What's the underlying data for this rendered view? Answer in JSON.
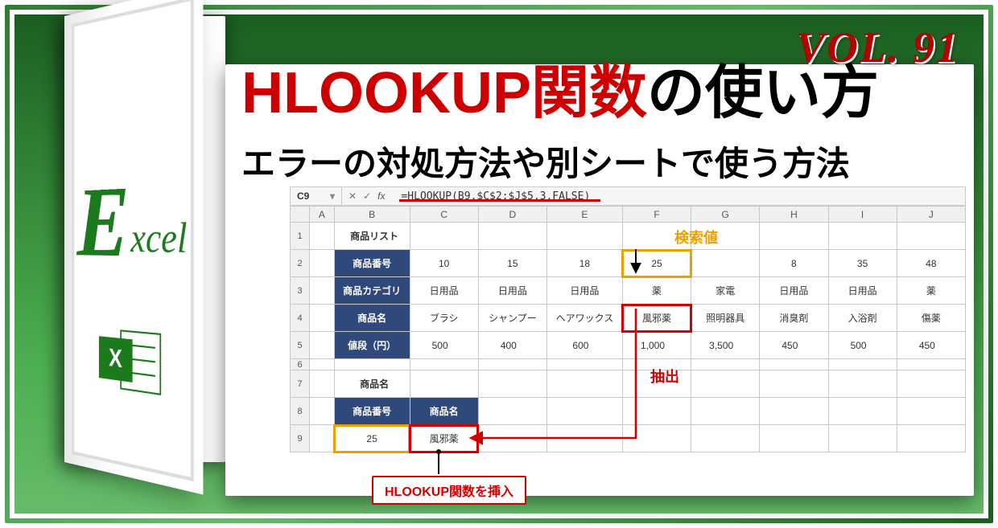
{
  "volume_label": "VOL. 91",
  "title": {
    "red": "HLOOKUP関数",
    "black": "の使い方"
  },
  "subtitle": "エラーの対処方法や別シートで使う方法",
  "door": {
    "letter": "E",
    "rest": "xcel",
    "icon_letter": "X"
  },
  "formula_bar": {
    "cell_ref": "C9",
    "dropdown_glyph": "▾",
    "cancel_glyph": "✕",
    "confirm_glyph": "✓",
    "fx_label": "fx",
    "formula": "=HLOOKUP(B9,$C$2:$J$5,3,FALSE)"
  },
  "columns": [
    "",
    "A",
    "B",
    "C",
    "D",
    "E",
    "F",
    "G",
    "H",
    "I",
    "J"
  ],
  "row_labels": [
    "1",
    "2",
    "3",
    "4",
    "5",
    "6",
    "7",
    "8",
    "9"
  ],
  "sheet": {
    "list_title": "商品リスト",
    "headers": {
      "number": "商品番号",
      "category": "商品カテゴリ",
      "name": "商品名",
      "price": "値段（円）"
    },
    "data": {
      "numbers": [
        "10",
        "15",
        "18",
        "25",
        "",
        "8",
        "35",
        "48"
      ],
      "categories": [
        "日用品",
        "日用品",
        "日用品",
        "薬",
        "家電",
        "日用品",
        "日用品",
        "薬"
      ],
      "names": [
        "ブラシ",
        "シャンプー",
        "ヘアワックス",
        "風邪薬",
        "照明器具",
        "消臭剤",
        "入浴剤",
        "傷薬"
      ],
      "prices": [
        "500",
        "400",
        "600",
        "1,000",
        "3,500",
        "450",
        "500",
        "450"
      ]
    },
    "result_section_title": "商品名",
    "result_headers": {
      "number": "商品番号",
      "name": "商品名"
    },
    "result_values": {
      "number": "25",
      "name": "風邪薬"
    }
  },
  "annotations": {
    "search_value": "検索値",
    "extract": "抽出",
    "insert_formula": "HLOOKUP関数を挿入"
  },
  "chart_data": {
    "type": "table",
    "title": "商品リスト",
    "columns": [
      "商品番号",
      "商品カテゴリ",
      "商品名",
      "値段（円）"
    ],
    "rows": [
      {
        "商品番号": 10,
        "商品カテゴリ": "日用品",
        "商品名": "ブラシ",
        "値段（円）": 500
      },
      {
        "商品番号": 15,
        "商品カテゴリ": "日用品",
        "商品名": "シャンプー",
        "値段（円）": 400
      },
      {
        "商品番号": 18,
        "商品カテゴリ": "日用品",
        "商品名": "ヘアワックス",
        "値段（円）": 600
      },
      {
        "商品番号": 25,
        "商品カテゴリ": "薬",
        "商品名": "風邪薬",
        "値段（円）": 1000
      },
      {
        "商品番号": null,
        "商品カテゴリ": "家電",
        "商品名": "照明器具",
        "値段（円）": 3500
      },
      {
        "商品番号": 8,
        "商品カテゴリ": "日用品",
        "商品名": "消臭剤",
        "値段（円）": 450
      },
      {
        "商品番号": 35,
        "商品カテゴリ": "日用品",
        "商品名": "入浴剤",
        "値段（円）": 500
      },
      {
        "商品番号": 48,
        "商品カテゴリ": "薬",
        "商品名": "傷薬",
        "値段（円）": 450
      }
    ],
    "lookup": {
      "key_column": "商品番号",
      "key_value": 25,
      "return_column": "商品名",
      "result": "風邪薬"
    },
    "formula": "=HLOOKUP(B9,$C$2:$J$5,3,FALSE)"
  }
}
